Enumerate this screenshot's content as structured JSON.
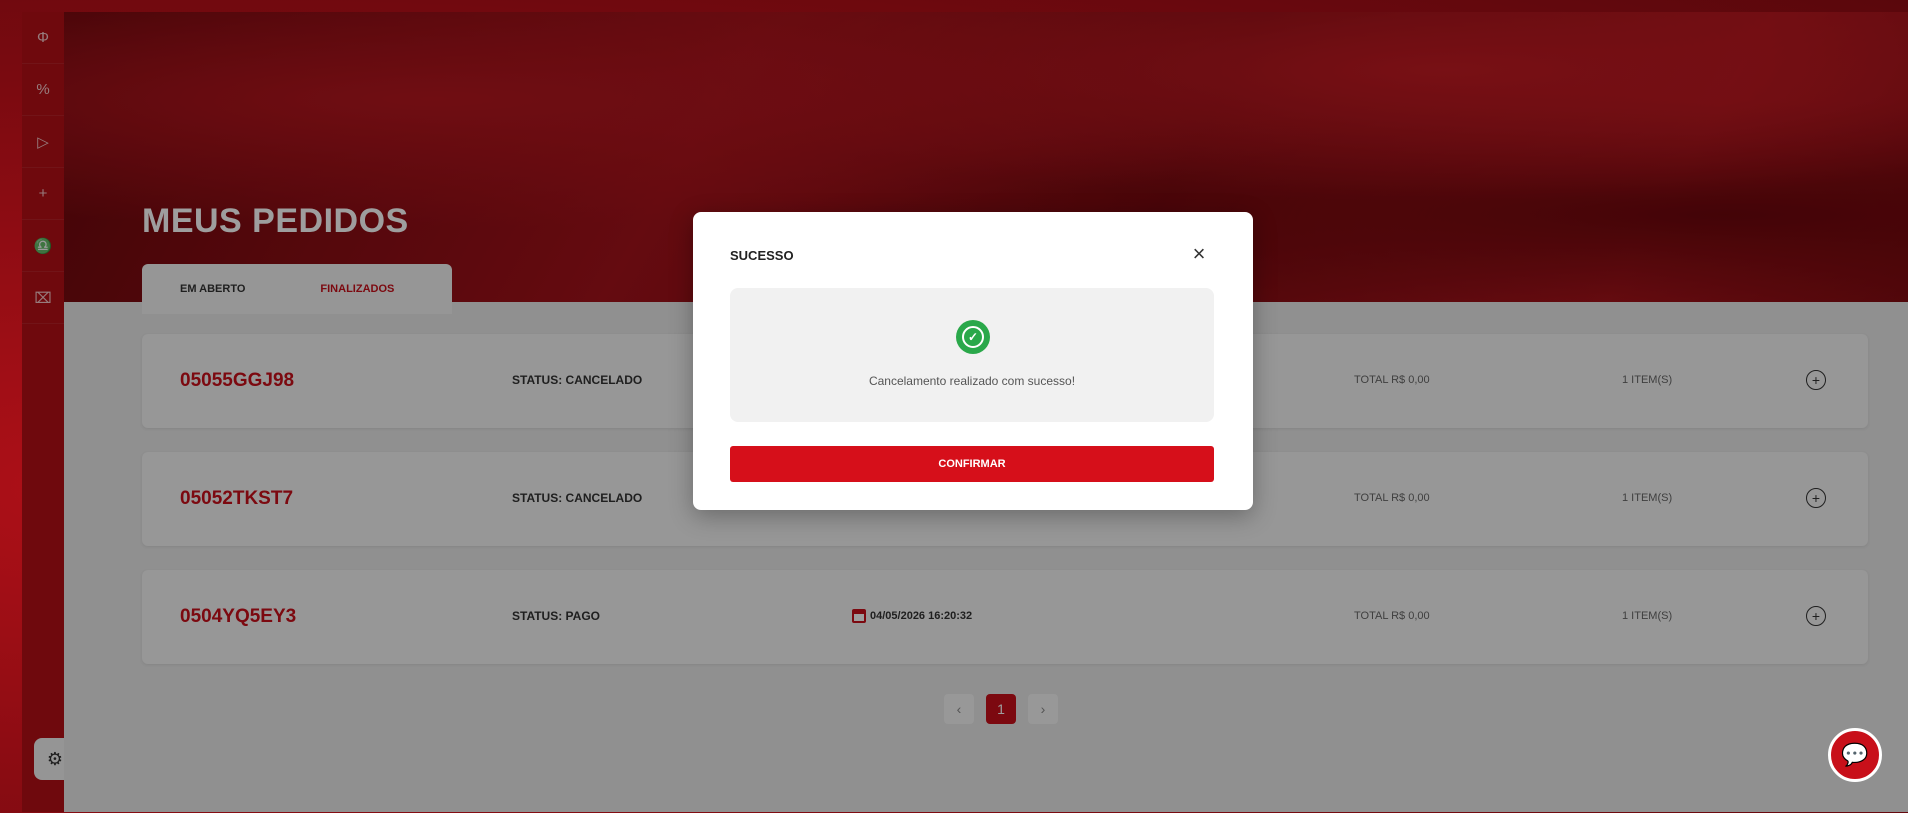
{
  "sidebar": {
    "items": [
      {
        "icon": "phi-icon",
        "glyph": "Φ"
      },
      {
        "icon": "percent-icon",
        "glyph": "%"
      },
      {
        "icon": "play-icon",
        "glyph": "▷"
      },
      {
        "icon": "plus-icon",
        "glyph": "+"
      },
      {
        "icon": "support-icon",
        "glyph": "♎"
      },
      {
        "icon": "ticket-icon",
        "glyph": "⌧"
      }
    ],
    "bottom_icon": {
      "icon": "cookie-settings-icon",
      "glyph": "⚙"
    }
  },
  "page": {
    "title": "MEUS PEDIDOS",
    "tabs": [
      {
        "label": "EM ABERTO",
        "active": false
      },
      {
        "label": "FINALIZADOS",
        "active": true
      }
    ]
  },
  "orders": [
    {
      "code": "05055GGJ98",
      "status": "STATUS: CANCELADO",
      "date": "",
      "total": "TOTAL R$ 0,00",
      "items": "1 ITEM(S)"
    },
    {
      "code": "05052TKST7",
      "status": "STATUS: CANCELADO",
      "date": "",
      "total": "TOTAL R$ 0,00",
      "items": "1 ITEM(S)"
    },
    {
      "code": "0504YQ5EY3",
      "status": "STATUS: PAGO",
      "date": "04/05/2026 16:20:32",
      "total": "TOTAL R$ 0,00",
      "items": "1 ITEM(S)"
    }
  ],
  "pagination": {
    "prev": "‹",
    "current": "1",
    "next": "›"
  },
  "modal": {
    "title": "SUCESSO",
    "close": "×",
    "message": "Cancelamento realizado com sucesso!",
    "confirm_label": "CONFIRMAR",
    "check_glyph": "✓"
  },
  "chat": {
    "icon": "chat-icon",
    "glyph": "💬"
  },
  "colors": {
    "brand_red": "#c8101a",
    "success_green": "#2aa84a"
  }
}
